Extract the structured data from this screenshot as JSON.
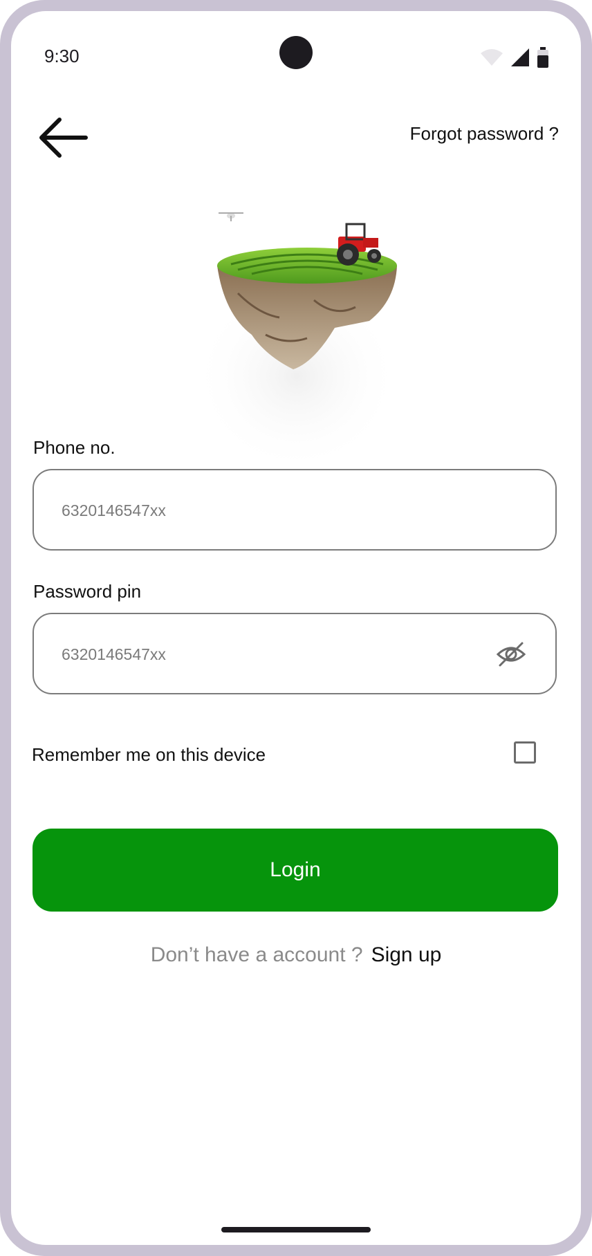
{
  "status_bar": {
    "time": "9:30"
  },
  "header": {
    "forgot_password": "Forgot password ?"
  },
  "form": {
    "phone_label": "Phone no.",
    "phone_placeholder": "6320146547xx",
    "password_label": "Password pin",
    "password_placeholder": "6320146547xx",
    "remember_label": "Remember me on this device",
    "remember_checked": false
  },
  "login_button": "Login",
  "signup": {
    "question": "Don’t have a account ?",
    "link": "Sign up"
  },
  "colors": {
    "primary": "#06940c",
    "frame": "#c9c2d3"
  },
  "icons": [
    "back-arrow-icon",
    "eye-off-icon",
    "wifi-icon",
    "signal-icon",
    "battery-icon"
  ]
}
